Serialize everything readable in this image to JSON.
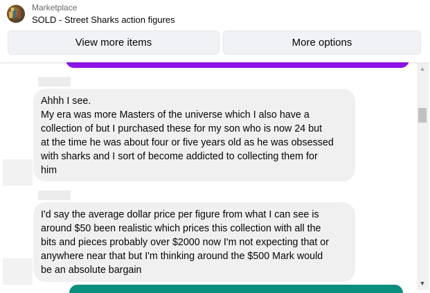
{
  "header": {
    "subtitle": "Marketplace",
    "title": "SOLD - Street Sharks action figures",
    "view_more_label": "View more items",
    "more_options_label": "More options"
  },
  "colors": {
    "sent_bubble": "#8e13e8",
    "received_bubble": "#f0f0f0",
    "teal_bubble": "#0a8f7e"
  },
  "scrollbar": {
    "up_icon": "▲",
    "down_icon": "▼"
  },
  "messages": [
    {
      "lines": [
        "Ahhh I see.",
        "My era was more Masters of the universe which I also have a",
        "collection of but I purchased these for my son who is now 24 but",
        "at the time he was about four or five years old as he was obsessed",
        "with sharks and I sort of become addicted to collecting them for",
        "him"
      ]
    },
    {
      "lines": [
        "I'd say the average dollar price per figure from what I can see is",
        "around $50 been realistic which prices this collection with all the",
        "bits and pieces probably over $2000 now I'm not expecting that or",
        "anywhere near that but I'm thinking around the $500 Mark would",
        "be an absolute bargain"
      ]
    }
  ]
}
